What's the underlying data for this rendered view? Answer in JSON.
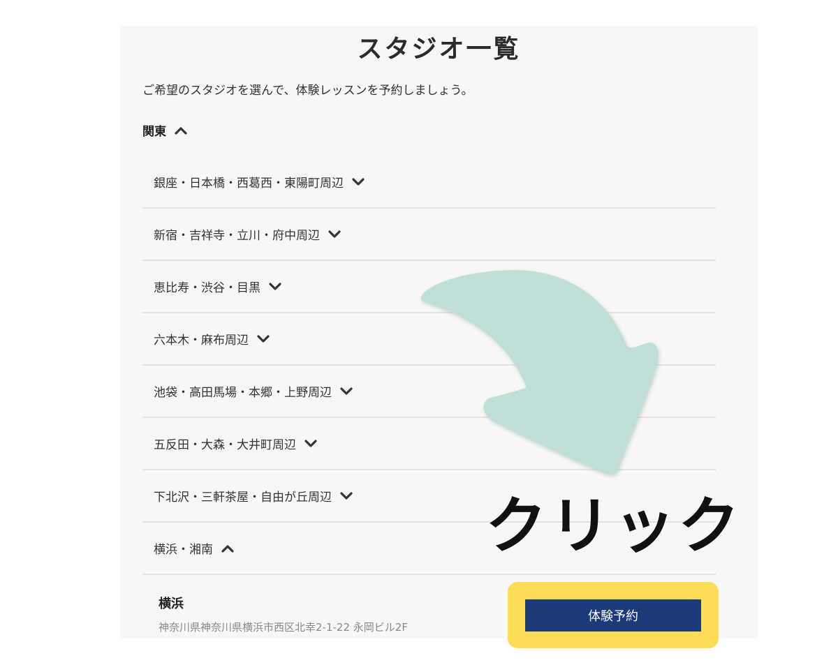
{
  "page": {
    "title": "スタジオ一覧",
    "intro": "ご希望のスタジオを選んで、体験レッスンを予約しましょう。"
  },
  "region": {
    "label": "関東",
    "icon": "chevron-up-icon"
  },
  "areas": [
    {
      "label": "銀座・日本橋・西葛西・東陽町周辺",
      "icon": "chevron-down-icon"
    },
    {
      "label": "新宿・吉祥寺・立川・府中周辺",
      "icon": "chevron-down-icon"
    },
    {
      "label": "恵比寿・渋谷・目黒",
      "icon": "chevron-down-icon"
    },
    {
      "label": "六本木・麻布周辺",
      "icon": "chevron-down-icon"
    },
    {
      "label": "池袋・高田馬場・本郷・上野周辺",
      "icon": "chevron-down-icon"
    },
    {
      "label": "五反田・大森・大井町周辺",
      "icon": "chevron-down-icon"
    },
    {
      "label": "下北沢・三軒茶屋・自由が丘周辺",
      "icon": "chevron-down-icon"
    },
    {
      "label": "横浜・湘南",
      "icon": "chevron-up-icon"
    }
  ],
  "studio": {
    "name": "横浜",
    "address": "神奈川県神奈川県横浜市西区北幸2-1-22 永岡ビル2F",
    "button_label": "体験予約"
  },
  "annotation": {
    "text": "クリック",
    "arrow_color": "#c0dfd8",
    "highlight_color": "#ffdc56"
  },
  "colors": {
    "panel_bg": "#f7f7f5",
    "button_bg": "#1a3a7a",
    "divider": "#e3e3e0"
  }
}
